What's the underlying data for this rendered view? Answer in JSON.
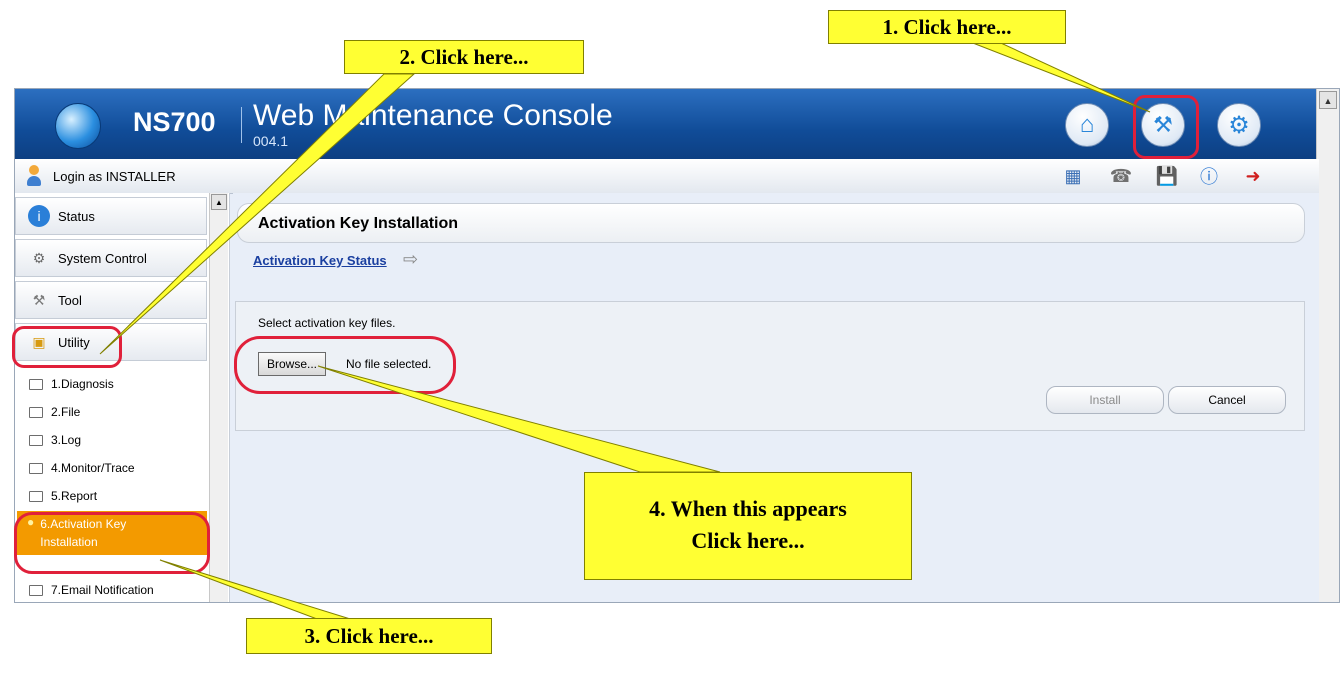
{
  "header": {
    "brand": "NS700",
    "product": "Web Maintenance Console",
    "version": "004.1",
    "buttons": [
      {
        "name": "home-button",
        "icon": "home-icon"
      },
      {
        "name": "tool-button",
        "icon": "wrench-icon"
      },
      {
        "name": "setup-button",
        "icon": "gear-icon"
      }
    ]
  },
  "toolbar": {
    "login_text": "Login as INSTALLER",
    "icons": [
      "schedule-icon",
      "phone-icon",
      "save-icon",
      "info-icon",
      "logout-icon"
    ]
  },
  "sidebar": {
    "menus": [
      {
        "label": "Status",
        "icon": "info-icon"
      },
      {
        "label": "System Control",
        "icon": "gear-icon"
      },
      {
        "label": "Tool",
        "icon": "tools-icon"
      },
      {
        "label": "Utility",
        "icon": "box-icon"
      }
    ],
    "sub_items": [
      {
        "label": "1.Diagnosis"
      },
      {
        "label": "2.File"
      },
      {
        "label": "3.Log"
      },
      {
        "label": "4.Monitor/Trace"
      },
      {
        "label": "5.Report"
      },
      {
        "label": "6.Activation Key Installation",
        "line1": "6.Activation Key",
        "line2": "Installation"
      },
      {
        "label": "7.Email Notification"
      }
    ]
  },
  "main": {
    "title": "Activation Key Installation",
    "status_link": "Activation Key Status",
    "instruction": "Select activation key files.",
    "browse_label": "Browse...",
    "file_status": "No file selected.",
    "install_label": "Install",
    "cancel_label": "Cancel"
  },
  "callouts": {
    "c1": "1. Click here...",
    "c2": "2. Click here...",
    "c3": "3. Click here...",
    "c4_line1": "4. When this appears",
    "c4_line2": "Click here..."
  },
  "colors": {
    "header_blue": "#104c98",
    "callout_yellow": "#ffff33",
    "highlight_red": "#e0203a",
    "active_orange": "#f39a00",
    "link_blue": "#1a3fa0"
  }
}
